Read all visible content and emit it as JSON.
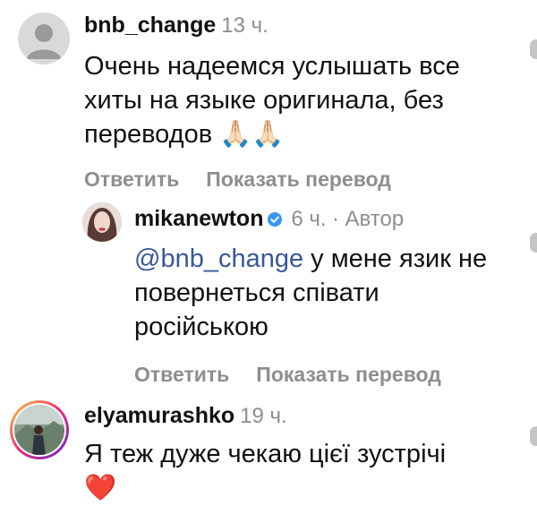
{
  "comments": [
    {
      "username": "bnb_change",
      "time": "13 ч.",
      "text": "Очень надеемся услышать все хиты на языке оригинала, без переводов",
      "emoji": "🙏🏻🙏🏻",
      "reply_label": "Ответить",
      "translate_label": "Показать перевод",
      "avatar_icon": "default-avatar-icon"
    },
    {
      "username": "mikanewton",
      "verified_icon": "verified-badge-icon",
      "time": "6 ч.",
      "separator": "·",
      "author_label": "Автор",
      "mention": "@bnb_change",
      "text_after_mention": "у мене язик не повернеться співати російською",
      "reply_label": "Ответить",
      "translate_label": "Показать перевод"
    },
    {
      "username": "elyamurashko",
      "time": "19 ч.",
      "text": "Я теж дуже чекаю цієї зустрічі",
      "emoji": "❤️"
    }
  ]
}
